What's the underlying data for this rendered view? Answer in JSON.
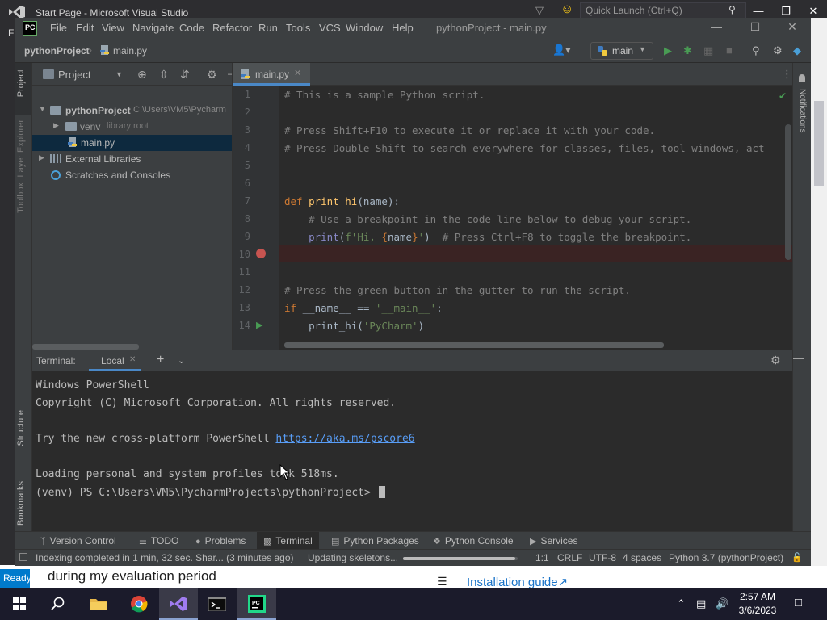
{
  "vs": {
    "title": "Start Page - Microsoft Visual Studio",
    "quick_launch": "Quick Launch (Ctrl+Q)",
    "menu_f": "F",
    "ready": "Ready",
    "eval_text": "during my evaluation period",
    "install_link": "Installation guide↗"
  },
  "pycharm": {
    "logo": "PC",
    "menu": [
      "File",
      "Edit",
      "View",
      "Navigate",
      "Code",
      "Refactor",
      "Run",
      "Tools",
      "VCS",
      "Window",
      "Help"
    ],
    "window_title": "pythonProject - main.py",
    "breadcrumb": {
      "project": "pythonProject",
      "file": "main.py"
    },
    "run_config": "main",
    "left_tabs": [
      "Project",
      "Layer Explorer",
      "Toolbox",
      "Structure",
      "Bookmarks"
    ],
    "right_tabs": [
      "Notifications"
    ]
  },
  "project_panel": {
    "title": "Project",
    "tree": [
      {
        "label": "pythonProject",
        "hint": "C:\\Users\\VM5\\Pycharm"
      },
      {
        "label": "venv",
        "hint": "library root"
      },
      {
        "label": "main.py",
        "hint": ""
      },
      {
        "label": "External Libraries",
        "hint": ""
      },
      {
        "label": "Scratches and Consoles",
        "hint": ""
      }
    ]
  },
  "editor": {
    "tab": "main.py",
    "line_numbers": [
      "1",
      "2",
      "3",
      "4",
      "5",
      "6",
      "7",
      "8",
      "9",
      "10",
      "11",
      "12",
      "13",
      "14"
    ],
    "lines": [
      "# This is a sample Python script.",
      "",
      "# Press Shift+F10 to execute it or replace it with your code.",
      "# Press Double Shift to search everywhere for classes, files, tool windows, act",
      "",
      "",
      "def print_hi(name):",
      "    # Use a breakpoint in the code line below to debug your script.",
      "    print(f'Hi, {name}')  # Press Ctrl+F8 to toggle the breakpoint.",
      "",
      "",
      "# Press the green button in the gutter to run the script.",
      "if __name__ == '__main__':",
      "    print_hi('PyCharm')"
    ]
  },
  "terminal": {
    "label": "Terminal:",
    "tab": "Local",
    "lines": [
      "Windows PowerShell",
      "Copyright (C) Microsoft Corporation. All rights reserved.",
      "",
      "Try the new cross-platform PowerShell ",
      "",
      "Loading personal and system profiles took 518ms.",
      "(venv) PS C:\\Users\\VM5\\PycharmProjects\\pythonProject> "
    ],
    "link": "https://aka.ms/pscore6"
  },
  "tool_tabs": [
    "Version Control",
    "TODO",
    "Problems",
    "Terminal",
    "Python Packages",
    "Python Console",
    "Services"
  ],
  "status": {
    "message": "Indexing completed in 1 min, 32 sec. Shar... (3 minutes ago)",
    "task": "Updating skeletons...",
    "progress": 0.98,
    "position": "1:1",
    "line_sep": "CRLF",
    "encoding": "UTF-8",
    "indent": "4 spaces",
    "interpreter": "Python 3.7 (pythonProject)"
  },
  "taskbar": {
    "time": "2:57 AM",
    "date": "3/6/2023"
  },
  "colors": {
    "accent": "#4a88c7",
    "keyword": "#cc7832",
    "function": "#ffc66d",
    "string": "#6a8759",
    "comment": "#808080",
    "breakpoint": "#c75450",
    "run": "#499c54",
    "vs_blue": "#007acc"
  }
}
